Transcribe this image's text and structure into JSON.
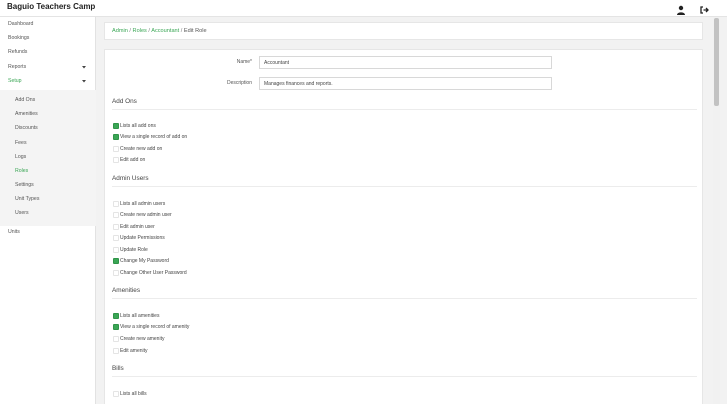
{
  "app": {
    "title": "Baguio Teachers Camp"
  },
  "topbar": {
    "user_icon": "user-icon",
    "logout_icon": "logout-icon"
  },
  "sidebar": {
    "items": [
      {
        "label": "Dashboard"
      },
      {
        "label": "Bookings"
      },
      {
        "label": "Refunds"
      },
      {
        "label": "Reports",
        "caret": "chevron-down-icon"
      },
      {
        "label": "Setup",
        "caret": "chevron-up-icon",
        "active": true
      }
    ],
    "submenu": [
      {
        "label": "Add Ons"
      },
      {
        "label": "Amenities"
      },
      {
        "label": "Discounts"
      },
      {
        "label": "Fees"
      },
      {
        "label": "Logs"
      },
      {
        "label": "Roles",
        "active": true
      },
      {
        "label": "Settings"
      },
      {
        "label": "Unit Types"
      },
      {
        "label": "Users"
      }
    ],
    "after": [
      {
        "label": "Units"
      }
    ]
  },
  "breadcrumb": {
    "items": [
      "Admin",
      "Roles",
      "Accountant"
    ],
    "current": "Edit Role",
    "separator": "/"
  },
  "form": {
    "name_label": "Name*",
    "name_value": "Accountant",
    "description_label": "Description",
    "description_value": "Manages finances and reports."
  },
  "sections": [
    {
      "title": "Add Ons",
      "perms": [
        {
          "label": "Lists all add ons",
          "checked": true
        },
        {
          "label": "View a single record of add on",
          "checked": true
        },
        {
          "label": "Create new add on",
          "checked": false
        },
        {
          "label": "Edit add on",
          "checked": false
        }
      ]
    },
    {
      "title": "Admin Users",
      "perms": [
        {
          "label": "Lists all admin users",
          "checked": false
        },
        {
          "label": "Create new admin user",
          "checked": false
        },
        {
          "label": "Edit admin user",
          "checked": false
        },
        {
          "label": "Update Permissions",
          "checked": false
        },
        {
          "label": "Update Role",
          "checked": false
        },
        {
          "label": "Change My Password",
          "checked": true
        },
        {
          "label": "Change Other User Password",
          "checked": false
        }
      ]
    },
    {
      "title": "Amenities",
      "perms": [
        {
          "label": "Lists all amenities",
          "checked": true
        },
        {
          "label": "View a single record of amenity",
          "checked": true
        },
        {
          "label": "Create new amenity",
          "checked": false
        },
        {
          "label": "Edit amenity",
          "checked": false
        }
      ]
    },
    {
      "title": "Bills",
      "perms": [
        {
          "label": "Lists all bills",
          "checked": false
        }
      ]
    }
  ],
  "colors": {
    "accent": "#3aa655",
    "background": "#f2f2f2",
    "panel": "#ffffff"
  }
}
